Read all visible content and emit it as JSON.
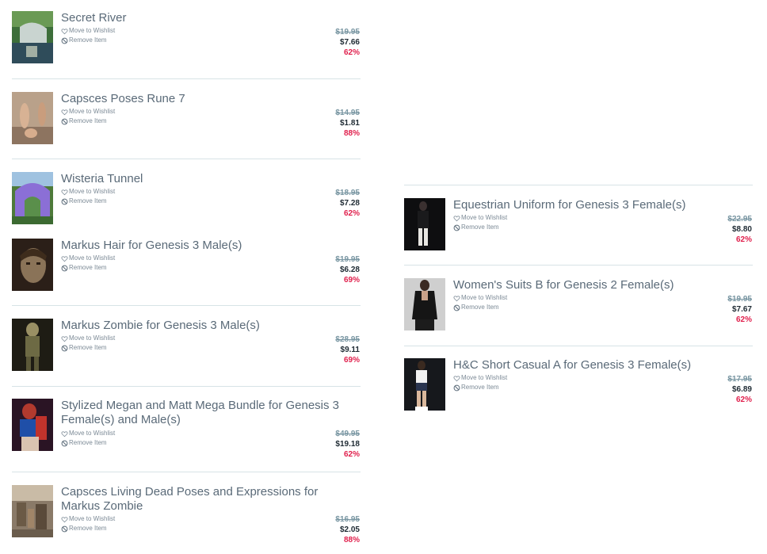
{
  "actions": {
    "wishlist": "Move to Wishlist",
    "remove": "Remove Item"
  },
  "icons": {
    "wishlist": "heart-outline-icon",
    "remove": "prohibited-circle-icon"
  },
  "colors": {
    "title": "#5a6a78",
    "old_price": "#7a97a3",
    "new_price": "#1e2a33",
    "discount": "#e01f4c",
    "divider": "#d7e3e6"
  },
  "cart_left": [
    {
      "title": "Secret River",
      "old_price": "$19.95",
      "new_price": "$7.66",
      "discount": "62%"
    },
    {
      "title": "Capsces Poses Rune 7",
      "old_price": "$14.95",
      "new_price": "$1.81",
      "discount": "88%"
    },
    {
      "title": "Wisteria Tunnel",
      "old_price": "$18.95",
      "new_price": "$7.28",
      "discount": "62%"
    },
    {
      "title": "Markus Hair for Genesis 3 Male(s)",
      "old_price": "$19.95",
      "new_price": "$6.28",
      "discount": "69%"
    },
    {
      "title": "Markus Zombie for Genesis 3 Male(s)",
      "old_price": "$28.95",
      "new_price": "$9.11",
      "discount": "69%"
    },
    {
      "title": "Stylized Megan and Matt Mega Bundle for Genesis 3 Female(s) and Male(s)",
      "old_price": "$49.95",
      "new_price": "$19.18",
      "discount": "62%"
    },
    {
      "title": "Capsces Living Dead Poses and Expressions for Markus Zombie",
      "old_price": "$16.95",
      "new_price": "$2.05",
      "discount": "88%"
    }
  ],
  "cart_right": [
    {
      "title": "Equestrian Uniform for Genesis 3 Female(s)",
      "old_price": "$22.95",
      "new_price": "$8.80",
      "discount": "62%"
    },
    {
      "title": "Women's Suits B for Genesis 2 Female(s)",
      "old_price": "$19.95",
      "new_price": "$7.67",
      "discount": "62%"
    },
    {
      "title": "H&C Short Casual A for Genesis 3 Female(s)",
      "old_price": "$17.95",
      "new_price": "$6.89",
      "discount": "62%"
    }
  ]
}
